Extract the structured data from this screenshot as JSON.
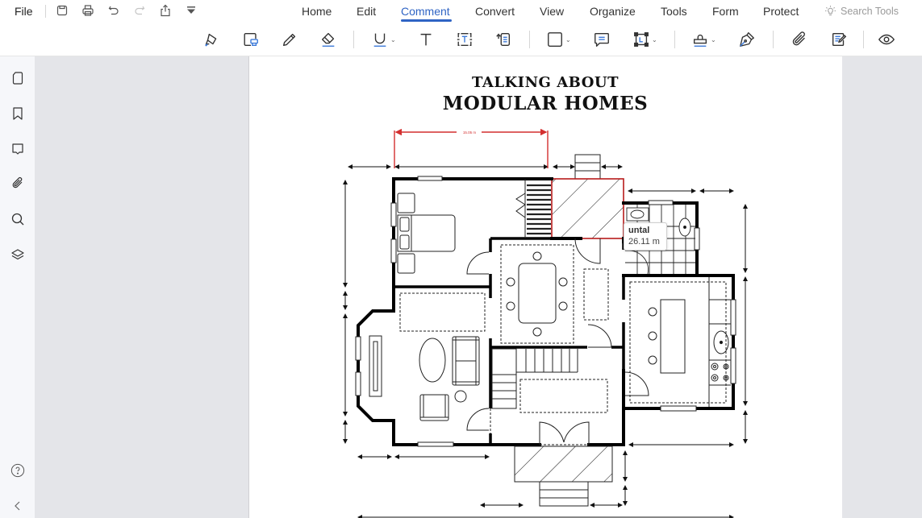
{
  "app": {
    "file_menu": "File",
    "quick_access": [
      "save-icon",
      "print-icon",
      "undo-icon",
      "redo-icon",
      "share-icon",
      "customize-icon"
    ],
    "menu_tabs": [
      {
        "label": "Home"
      },
      {
        "label": "Edit"
      },
      {
        "label": "Comment",
        "active": true
      },
      {
        "label": "Convert"
      },
      {
        "label": "View"
      },
      {
        "label": "Organize"
      },
      {
        "label": "Tools"
      },
      {
        "label": "Form"
      },
      {
        "label": "Protect"
      }
    ],
    "search_tools": "Search Tools",
    "accent_color": "#2f64c4"
  },
  "toolbar": {
    "tools": [
      {
        "name": "highlight",
        "icon": "highlighter-icon"
      },
      {
        "name": "area-highlight",
        "icon": "area-highlight-icon"
      },
      {
        "name": "pencil",
        "icon": "pencil-icon"
      },
      {
        "name": "eraser",
        "icon": "eraser-icon"
      },
      {
        "name": "underline",
        "icon": "underline-icon",
        "has_dropdown": true
      },
      {
        "name": "typewriter",
        "icon": "text-icon"
      },
      {
        "name": "text-box",
        "icon": "text-box-icon"
      },
      {
        "name": "callout",
        "icon": "callout-icon"
      },
      {
        "name": "shape",
        "icon": "rectangle-icon",
        "has_dropdown": true
      },
      {
        "name": "note",
        "icon": "note-icon"
      },
      {
        "name": "measure",
        "icon": "measure-icon",
        "has_dropdown": true
      },
      {
        "name": "stamp",
        "icon": "stamp-icon",
        "has_dropdown": true
      },
      {
        "name": "signature",
        "icon": "pen-nib-icon"
      },
      {
        "name": "attachment",
        "icon": "paperclip-icon"
      },
      {
        "name": "comment-list",
        "icon": "edit-document-icon"
      },
      {
        "name": "show-hide",
        "icon": "eye-icon"
      }
    ]
  },
  "sidebar": {
    "items": [
      {
        "name": "thumbnails",
        "icon": "page-icon"
      },
      {
        "name": "bookmarks",
        "icon": "bookmark-icon"
      },
      {
        "name": "comments",
        "icon": "comment-icon"
      },
      {
        "name": "attachments",
        "icon": "paperclip-icon"
      },
      {
        "name": "search",
        "icon": "search-icon"
      },
      {
        "name": "layers",
        "icon": "layers-icon"
      }
    ],
    "bottom": [
      {
        "name": "help",
        "icon": "help-icon"
      },
      {
        "name": "collapse",
        "icon": "chevron-left-icon"
      }
    ]
  },
  "document": {
    "title_line1": "TALKING ABOUT",
    "title_line2": "MODULAR HOMES",
    "measure_line_label": "15.05 m",
    "measure_color": "#d32f2f",
    "tooltip": {
      "title": "untal",
      "value": "26.11 m"
    }
  }
}
